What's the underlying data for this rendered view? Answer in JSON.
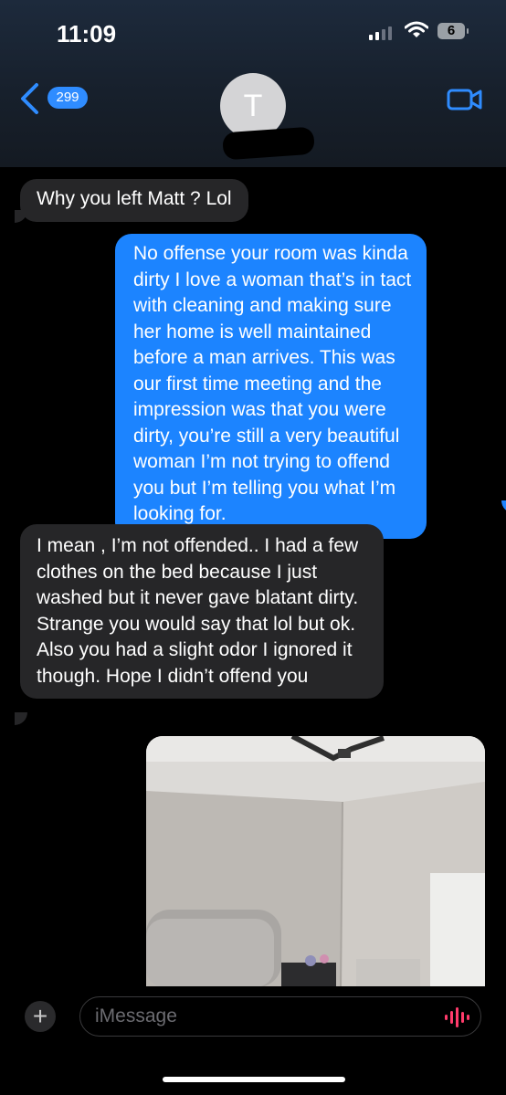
{
  "status_bar": {
    "time": "11:09",
    "battery": "6"
  },
  "header": {
    "back_count": "299",
    "contact_initial": "T"
  },
  "messages": [
    {
      "direction": "incoming",
      "text": "Why you left Matt ? Lol"
    },
    {
      "direction": "outgoing",
      "text": "No offense your room was kinda dirty I love a woman that’s in tact with cleaning and making sure her home is well maintained before a man arrives. This was our first time meeting and the impression was that you were dirty, you’re still a very beautiful woman I’m not trying to offend you but I’m telling you what I’m looking for."
    },
    {
      "direction": "incoming",
      "text": "I mean , I’m not offended.. I had a few clothes on the bed because I just washed but it never gave blatant dirty. Strange you would say that lol but ok. Also you had a slight odor I ignored it though. Hope I didn’t offend you"
    }
  ],
  "input": {
    "placeholder": "iMessage"
  },
  "colors": {
    "incoming_bubble": "#262628",
    "outgoing_bubble": "#1c84ff",
    "accent": "#2f8cff"
  },
  "icons": [
    "back-chevron-icon",
    "video-call-icon",
    "plus-icon",
    "audio-waveform-icon",
    "wifi-icon",
    "signal-icon",
    "battery-icon"
  ]
}
